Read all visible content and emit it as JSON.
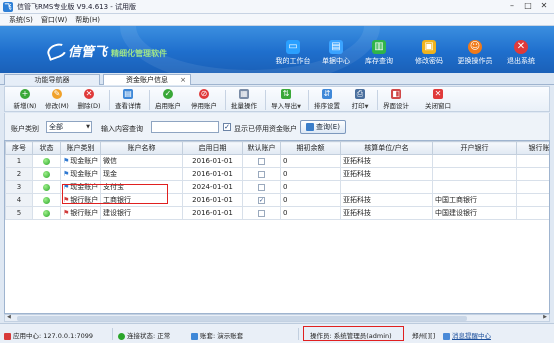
{
  "window": {
    "title": "信管飞RMS专业版 V9.4.613 - 试用版",
    "minimize": "–",
    "maximize": "□",
    "close": "✕"
  },
  "menu": [
    "系统(S)",
    "窗口(W)",
    "帮助(H)"
  ],
  "brand": {
    "name": "信管飞",
    "tagline": "精细化管理软件"
  },
  "nav": [
    {
      "label": "我的工作台",
      "icon": "monitor-icon",
      "color": "#2aa0ff"
    },
    {
      "label": "单据中心",
      "icon": "document-icon",
      "color": "#3aa3ff"
    },
    {
      "label": "库存查询",
      "icon": "book-icon",
      "color": "#2fb44a"
    },
    {
      "label": "修改密码",
      "icon": "lock-icon",
      "color": "#f0b31c"
    },
    {
      "label": "更换操作员",
      "icon": "user-icon",
      "color": "#f07a1a"
    },
    {
      "label": "退出系统",
      "icon": "exit-icon",
      "color": "#e03a3a"
    }
  ],
  "tabs": [
    {
      "label": "功能导航器"
    },
    {
      "label": "资金账户信息",
      "close": "×"
    }
  ],
  "toolbar": [
    {
      "label": "新增(N)",
      "icon": "add-icon",
      "color": "#3aa838"
    },
    {
      "label": "修改(M)",
      "icon": "edit-icon",
      "color": "#f0a12a"
    },
    {
      "label": "删除(D)",
      "icon": "delete-icon",
      "color": "#e03a3a"
    },
    {
      "label": "查看详情",
      "icon": "details-icon",
      "color": "#3f88d8"
    },
    {
      "label": "启用账户",
      "icon": "enable-icon",
      "color": "#3aa838"
    },
    {
      "label": "停用账户",
      "icon": "disable-icon",
      "color": "#e03a3a"
    },
    {
      "label": "批量操作",
      "icon": "batch-icon",
      "color": "#7a8ca6"
    },
    {
      "label": "导入导出",
      "icon": "import-export-icon",
      "color": "#3aa838"
    },
    {
      "label": "排序设置",
      "icon": "sort-icon",
      "color": "#3f88d8"
    },
    {
      "label": "打印",
      "icon": "print-icon",
      "color": "#4a6f9e"
    },
    {
      "label": "界面设计",
      "icon": "design-icon",
      "color": "#d04848"
    },
    {
      "label": "关闭窗口",
      "icon": "close-window-icon",
      "color": "#e03a3a"
    }
  ],
  "filter": {
    "account_type_label": "账户类别",
    "account_type_value": "全部",
    "query_label": "输入内容查询",
    "query_value": "",
    "show_disabled_label": "显示已停用资金账户",
    "query_button": "查询(E)"
  },
  "grid": {
    "columns": [
      "序号",
      "状态",
      "账户类别",
      "账户名称",
      "启用日期",
      "默认账户",
      "期初余额",
      "核算单位/户名",
      "开户银行",
      "银行账号"
    ],
    "rows": [
      {
        "no": "1",
        "type": "现金账户",
        "name": "微信",
        "date": "2016-01-01",
        "default": false,
        "balance": "0",
        "unit": "亚拓科技",
        "bank": "",
        "account": ""
      },
      {
        "no": "2",
        "type": "现金账户",
        "name": "现金",
        "date": "2016-01-01",
        "default": false,
        "balance": "0",
        "unit": "亚拓科技",
        "bank": "",
        "account": ""
      },
      {
        "no": "3",
        "type": "现金账户",
        "name": "支付宝",
        "date": "2024-01-01",
        "default": false,
        "balance": "0",
        "unit": "",
        "bank": "",
        "account": ""
      },
      {
        "no": "4",
        "type": "银行账户",
        "name": "工商银行",
        "date": "2016-01-01",
        "default": true,
        "balance": "0",
        "unit": "亚拓科技",
        "bank": "中国工商银行",
        "account": ""
      },
      {
        "no": "5",
        "type": "银行账户",
        "name": "建设银行",
        "date": "2016-01-01",
        "default": false,
        "balance": "0",
        "unit": "亚拓科技",
        "bank": "中国建设银行",
        "account": ""
      }
    ]
  },
  "status": {
    "app_center": "应用中心: 127.0.0.1:7099",
    "connection": "连接状态: 正常",
    "account_set": "账套: 演示账套",
    "operator": "操作员: 系统管理员(admin)",
    "region": "郑州[][]",
    "message_center": "消息提醒中心"
  }
}
